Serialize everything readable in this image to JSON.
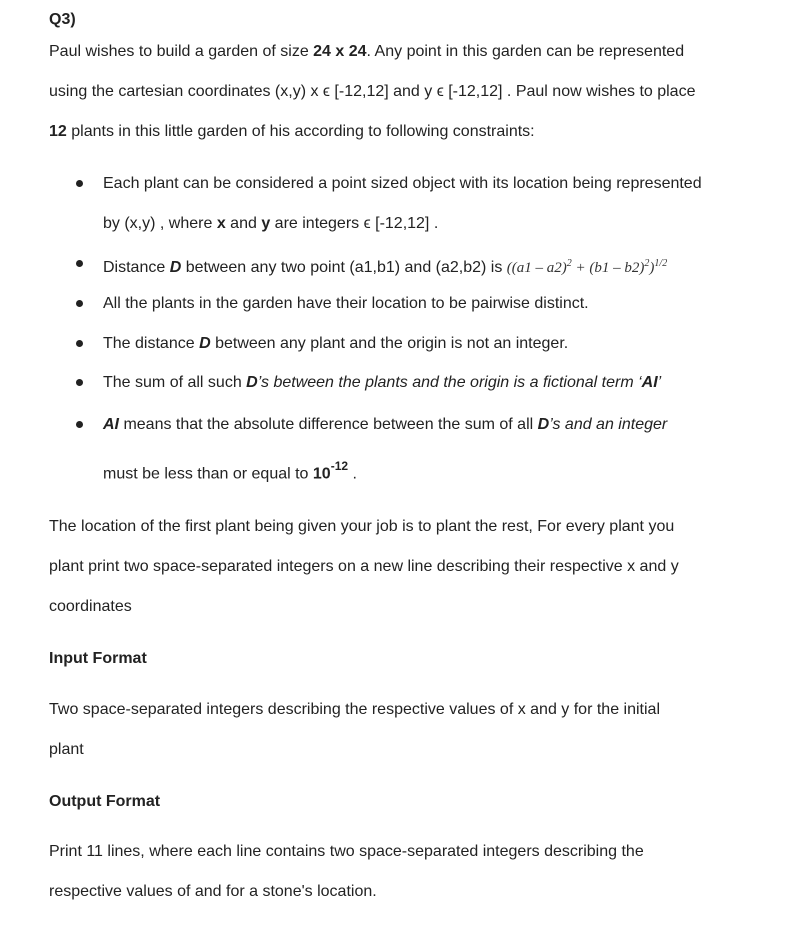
{
  "question_label": "Q3)",
  "intro": {
    "l1_a": "Paul wishes to build a garden of size ",
    "l1_b": "24 x 24",
    "l1_c": ". Any point in this garden can be represented",
    "l2": "using the cartesian coordinates (x,y) x ϵ [-12,12] and y ϵ [-12,12] . Paul now wishes to place",
    "l3_a": "12",
    "l3_b": " plants in this little garden of his according to following constraints:"
  },
  "bullets": {
    "b1_l1": "Each plant can be considered a point sized object with its location being represented",
    "b1_l2_a": "by (x,y) , where ",
    "b1_l2_x": "x",
    "b1_l2_b": " and ",
    "b1_l2_y": "y",
    "b1_l2_c": " are integers ϵ [-12,12]  .",
    "b2_a": "Distance ",
    "b2_D": "D",
    "b2_b": " between any two point (a1,b1) and (a2,b2) is ",
    "b2_formula": "((a1 – a2)",
    "b2_formula_sq1": "2",
    "b2_formula_mid": "  +  (b1 – b2)",
    "b2_formula_sq2": "2",
    "b2_formula_end": ")",
    "b2_formula_exp": "1/2",
    "b3": "All the plants in the garden have their location to be pairwise distinct.",
    "b4_a": "The distance ",
    "b4_D": "D",
    "b4_b": " between any plant and the origin is not an integer.",
    "b5_a": "The sum of all such ",
    "b5_D": "D",
    "b5_b": "’s between the plants and the origin is a fictional term ‘",
    "b5_AI": "AI",
    "b5_c": "’",
    "b6_AI": "AI",
    "b6_a": " means that the absolute difference between the sum of all ",
    "b6_D": "D",
    "b6_b": "’s and an integer",
    "b6_l2_a": "must be less than or equal to ",
    "b6_l2_10": "10",
    "b6_l2_exp": "-12",
    "b6_l2_end": " ."
  },
  "body": {
    "p1_l1": "The location of the first plant being given your job is to plant the rest, For every plant you",
    "p1_l2": "plant print two space-separated integers on a new line describing their respective x and y",
    "p1_l3": "coordinates"
  },
  "input_format": {
    "heading": "Input Format",
    "l1": "Two space-separated integers describing the respective values of x and y  for the initial",
    "l2": "plant"
  },
  "output_format": {
    "heading": "Output Format",
    "l1": "Print 11 lines, where each line contains two space-separated integers describing the",
    "l2": "respective values of  and  for a stone's location."
  }
}
